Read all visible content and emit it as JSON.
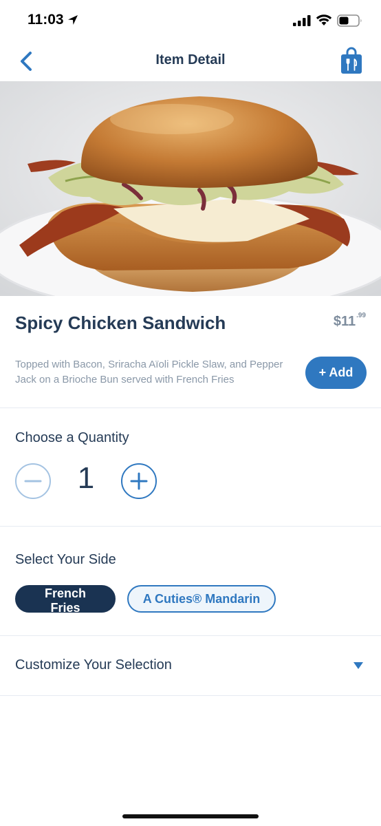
{
  "status_bar": {
    "time": "11:03"
  },
  "nav": {
    "title": "Item Detail",
    "back_icon": "chevron-left-icon",
    "bag_icon": "shopping-bag-icon"
  },
  "item": {
    "name": "Spicy Chicken Sandwich",
    "price_dollars": "$11",
    "price_cents": ".99",
    "description": "Topped with Bacon, Sriracha Aïoli Pickle Slaw, and Pepper Jack on a Brioche Bun served with French Fries",
    "add_label": "+ Add"
  },
  "quantity": {
    "label": "Choose a Quantity",
    "value": "1"
  },
  "side": {
    "label": "Select Your Side",
    "options": [
      {
        "label": "French Fries",
        "selected": true
      },
      {
        "label": "A Cuties® Mandarin",
        "selected": false
      }
    ]
  },
  "customize": {
    "label": "Customize Your Selection"
  },
  "colors": {
    "accent": "#2f78c0",
    "navy": "#253b56",
    "selected_pill": "#1a3352",
    "muted_text": "#8a98a8"
  }
}
